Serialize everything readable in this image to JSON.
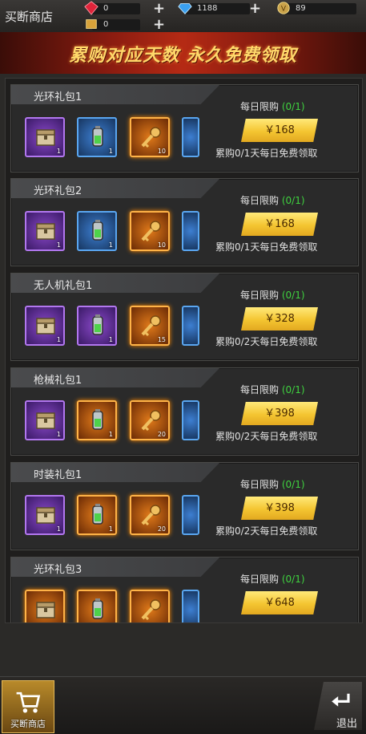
{
  "header": {
    "title": "买断商店",
    "resources": [
      {
        "name": "ruby",
        "value": "0"
      },
      {
        "name": "diamond",
        "value": "1188"
      },
      {
        "name": "coin",
        "value": "89"
      },
      {
        "name": "ticket",
        "value": "0"
      }
    ]
  },
  "banner": {
    "text": "累购对应天数 永久免费领取"
  },
  "packs": [
    {
      "name": "光环礼包1",
      "limit_label": "每日限购",
      "limit_count": "(0/1)",
      "price": "￥168",
      "accum": "累购0/1天每日免费领取",
      "items": [
        {
          "color": "purple",
          "count": "1",
          "icon": "chest-icon"
        },
        {
          "color": "blue",
          "count": "1",
          "icon": "battery-icon"
        },
        {
          "color": "orange",
          "count": "10",
          "icon": "key-icon"
        }
      ]
    },
    {
      "name": "光环礼包2",
      "limit_label": "每日限购",
      "limit_count": "(0/1)",
      "price": "￥168",
      "accum": "累购0/1天每日免费领取",
      "items": [
        {
          "color": "purple",
          "count": "1",
          "icon": "chest-icon"
        },
        {
          "color": "blue",
          "count": "1",
          "icon": "battery-icon"
        },
        {
          "color": "orange",
          "count": "10",
          "icon": "key-icon"
        }
      ]
    },
    {
      "name": "无人机礼包1",
      "limit_label": "每日限购",
      "limit_count": "(0/1)",
      "price": "￥328",
      "accum": "累购0/2天每日免费领取",
      "items": [
        {
          "color": "purple",
          "count": "1",
          "icon": "chest-icon"
        },
        {
          "color": "purple",
          "count": "1",
          "icon": "battery-icon"
        },
        {
          "color": "orange",
          "count": "15",
          "icon": "key-icon"
        }
      ]
    },
    {
      "name": "枪械礼包1",
      "limit_label": "每日限购",
      "limit_count": "(0/1)",
      "price": "￥398",
      "accum": "累购0/2天每日免费领取",
      "items": [
        {
          "color": "purple",
          "count": "1",
          "icon": "chest-icon"
        },
        {
          "color": "orange",
          "count": "1",
          "icon": "battery-icon"
        },
        {
          "color": "orange",
          "count": "20",
          "icon": "key-icon"
        }
      ]
    },
    {
      "name": "时装礼包1",
      "limit_label": "每日限购",
      "limit_count": "(0/1)",
      "price": "￥398",
      "accum": "累购0/2天每日免费领取",
      "items": [
        {
          "color": "purple",
          "count": "1",
          "icon": "chest-icon"
        },
        {
          "color": "orange",
          "count": "1",
          "icon": "battery-icon"
        },
        {
          "color": "orange",
          "count": "20",
          "icon": "key-icon"
        }
      ]
    },
    {
      "name": "光环礼包3",
      "limit_label": "每日限购",
      "limit_count": "(0/1)",
      "price": "￥648",
      "accum": "",
      "items": [
        {
          "color": "orange",
          "count": "",
          "icon": "chest-icon"
        },
        {
          "color": "orange",
          "count": "",
          "icon": "battery-icon"
        },
        {
          "color": "orange",
          "count": "",
          "icon": "key-icon"
        }
      ]
    }
  ],
  "footer": {
    "shop_label": "买断商店",
    "exit_label": "退出"
  }
}
